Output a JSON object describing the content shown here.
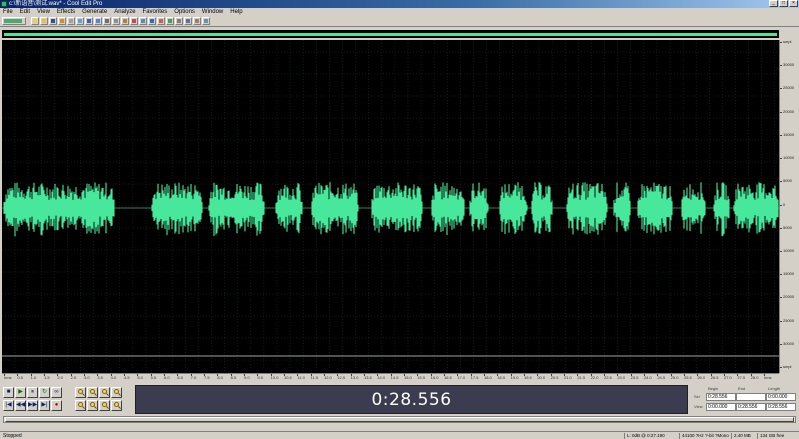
{
  "window": {
    "title": "c:\\新语音\\测试.wav* - Cool Edit Pro"
  },
  "menu": {
    "items": [
      "File",
      "Edit",
      "View",
      "Effects",
      "Generate",
      "Analyze",
      "Favorites",
      "Options",
      "Window",
      "Help"
    ]
  },
  "ruler": {
    "vertical_labels": [
      "smpl",
      "30000",
      "25000",
      "20000",
      "15000",
      "10000",
      "5000",
      "0",
      "5000",
      "10000",
      "15000",
      "20000",
      "25000",
      "30000",
      "smpl"
    ],
    "horizontal_labels": [
      "hms",
      "0.5",
      "1.0",
      "1.5",
      "2.0",
      "2.5",
      "3.0",
      "3.5",
      "4.0",
      "4.5",
      "5.0",
      "5.5",
      "6.0",
      "6.5",
      "7.0",
      "7.5",
      "8.0",
      "8.5",
      "9.0",
      "9.5",
      "10.0",
      "10.5",
      "11.0",
      "11.5",
      "12.0",
      "12.5",
      "13.0",
      "13.5",
      "14.0",
      "14.5",
      "15.0",
      "15.5",
      "16.0",
      "16.5",
      "17.0",
      "17.5",
      "18.0",
      "18.5",
      "19.0",
      "19.5",
      "20.0",
      "20.5",
      "21.0",
      "21.5",
      "22.0",
      "22.5",
      "23.0",
      "23.5",
      "24.0",
      "24.5",
      "25.0",
      "25.5",
      "26.0",
      "26.5",
      "27.0",
      "27.5",
      "28.0",
      "hms"
    ]
  },
  "transport": {
    "row1": [
      "■",
      "▶",
      "⏸",
      "↻",
      "∞"
    ],
    "row2": [
      "|◀",
      "◀◀",
      "▶▶",
      "▶|",
      "●"
    ]
  },
  "time_display": "0:28.556",
  "selection": {
    "begin_label": "Begin",
    "end_label": "End",
    "length_label": "Length",
    "sel_label": "Sel",
    "view_label": "View",
    "sel_begin": "0:28.556",
    "sel_end": "",
    "sel_length": "0:00.000",
    "view_begin": "0:00.000",
    "view_end": "0:28.556",
    "view_length": "0:28.556"
  },
  "status": {
    "left": "Stopped",
    "level": "L: 0dB @ 0:27.190",
    "format": "44100 ?Hz ?-bit ?Mono",
    "size": "2.40 MB",
    "free": "134 GB free"
  },
  "colors": {
    "waveform": "#47e89b",
    "background": "#000000",
    "grid": "#1f3a1f"
  }
}
